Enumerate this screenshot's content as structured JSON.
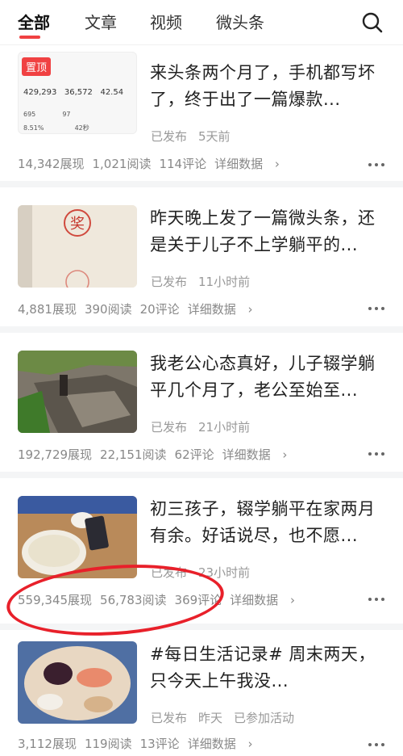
{
  "tabs": [
    {
      "label": "全部",
      "active": true
    },
    {
      "label": "文章",
      "active": false
    },
    {
      "label": "视频",
      "active": false
    },
    {
      "label": "微头条",
      "active": false
    }
  ],
  "search_icon": "search-icon",
  "articles": [
    {
      "title": "来头条两个月了，手机都写坏了，终于出了一篇爆款...",
      "pinned": true,
      "pin_label": "置顶",
      "thumb_text": {
        "row1": [
          "429,293",
          "36,572",
          "42.54"
        ],
        "row2": [
          "695",
          "97"
        ],
        "row3": [
          "8.51%",
          "42秒"
        ]
      },
      "meta": [
        "已发布",
        "5天前"
      ],
      "impressions": "14,342展现",
      "reads": "1,021阅读",
      "comments": "114评论",
      "detail": "详细数据"
    },
    {
      "title": "昨天晚上发了一篇微头条，还是关于儿子不上学躺平的...",
      "thumb_text": {
        "stamp": "奖"
      },
      "meta": [
        "已发布",
        "11小时前"
      ],
      "impressions": "4,881展现",
      "reads": "390阅读",
      "comments": "20评论",
      "detail": "详细数据"
    },
    {
      "title": "我老公心态真好，儿子辍学躺平几个月了，老公至始至...",
      "meta": [
        "已发布",
        "21小时前"
      ],
      "impressions": "192,729展现",
      "reads": "22,151阅读",
      "comments": "62评论",
      "detail": "详细数据"
    },
    {
      "title": "初三孩子，辍学躺平在家两月有余。好话说尽，也不愿...",
      "meta": [
        "已发布",
        "23小时前"
      ],
      "impressions": "559,345展现",
      "reads": "56,783阅读",
      "comments": "369评论",
      "detail": "详细数据",
      "highlighted": true
    },
    {
      "title": "#每日生活记录# 周末两天，只今天上午我没...",
      "meta": [
        "已发布",
        "昨天",
        "已参加活动"
      ],
      "impressions": "3,112展现",
      "reads": "119阅读",
      "comments": "13评论",
      "detail": "详细数据"
    }
  ],
  "colors": {
    "accent": "#f04142",
    "highlight_circle": "#e8202a"
  }
}
